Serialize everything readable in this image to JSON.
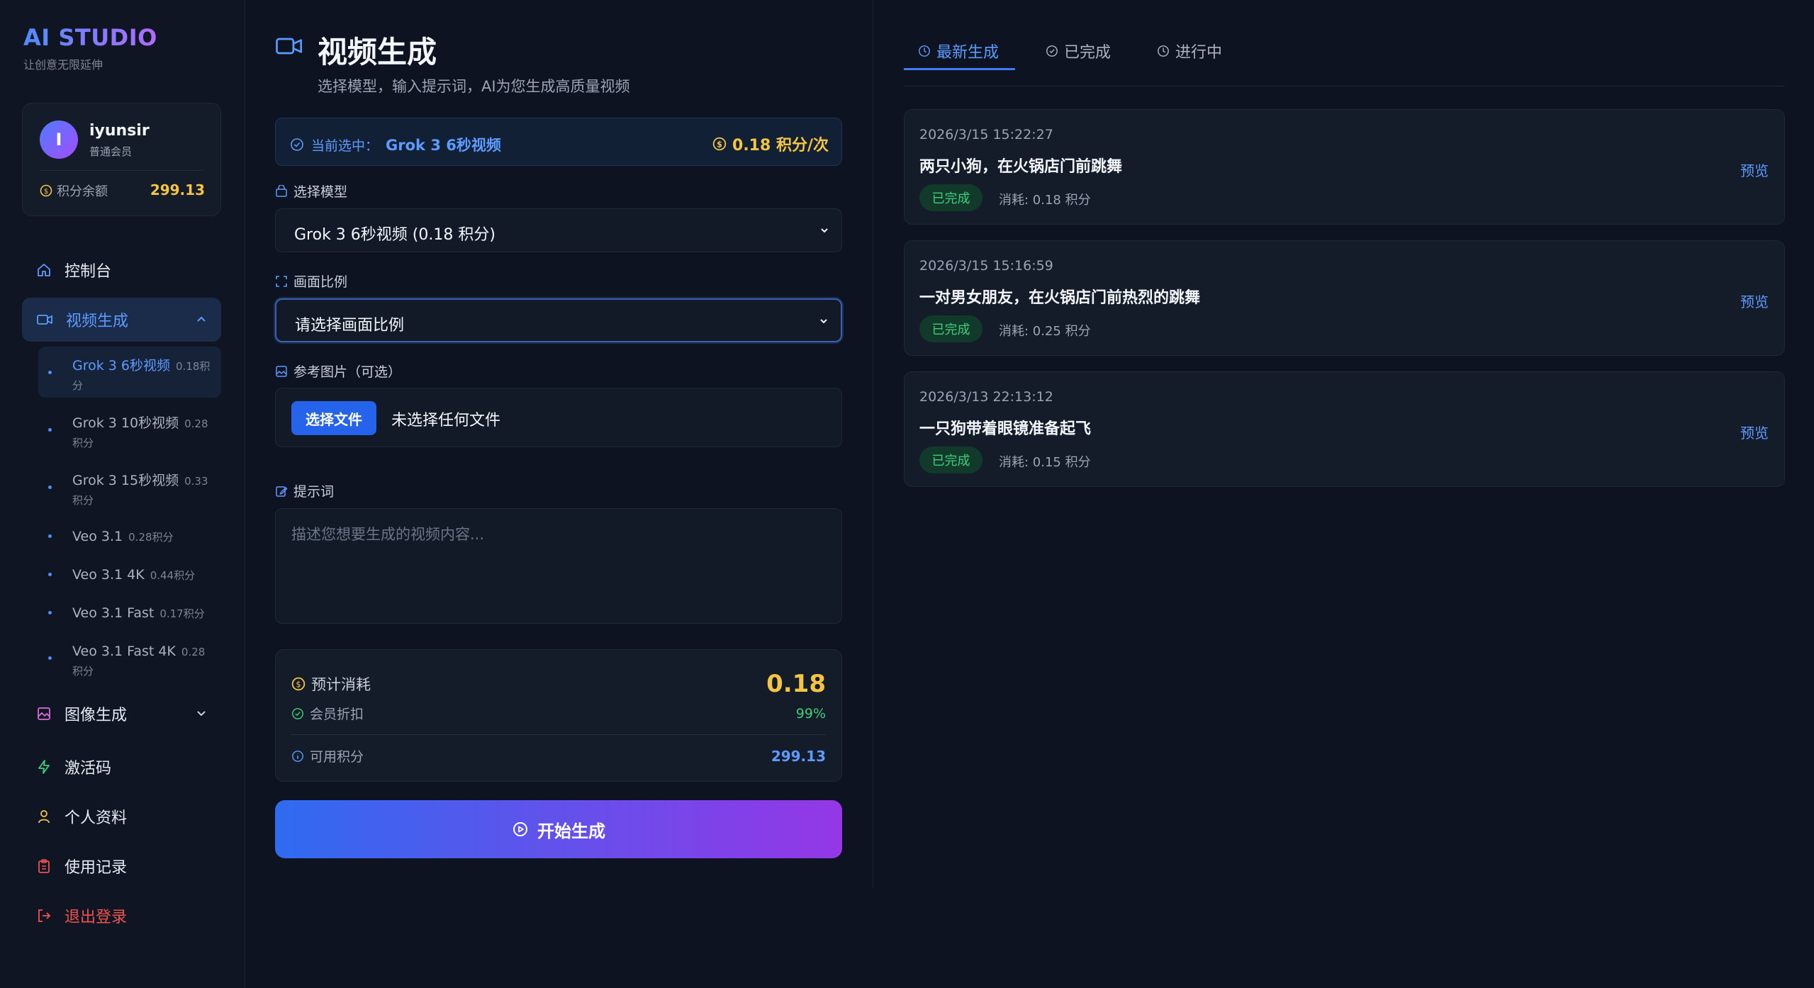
{
  "brand": {
    "title": "AI STUDIO",
    "subtitle": "让创意无限延伸"
  },
  "user": {
    "initial": "I",
    "name": "iyunsir",
    "role": "普通会员",
    "balance_label": "积分余额",
    "balance": "299.13"
  },
  "nav": {
    "dashboard": "控制台",
    "video": "视频生成",
    "image": "图像生成",
    "activation": "激活码",
    "profile": "个人资料",
    "history": "使用记录",
    "logout": "退出登录"
  },
  "video_models": [
    {
      "name": "Grok 3 6秒视频",
      "cost": "0.18积分"
    },
    {
      "name": "Grok 3 10秒视频",
      "cost": "0.28积分"
    },
    {
      "name": "Grok 3 15秒视频",
      "cost": "0.33积分"
    },
    {
      "name": "Veo 3.1",
      "cost": "0.28积分"
    },
    {
      "name": "Veo 3.1 4K",
      "cost": "0.44积分"
    },
    {
      "name": "Veo 3.1 Fast",
      "cost": "0.17积分"
    },
    {
      "name": "Veo 3.1 Fast 4K",
      "cost": "0.28积分"
    }
  ],
  "page": {
    "title": "视频生成",
    "subtitle": "选择模型，输入提示词，AI为您生成高质量视频",
    "selected_prefix": "当前选中：",
    "selected_model": "Grok 3 6秒视频",
    "selected_price": "0.18 积分/次",
    "model_label": "选择模型",
    "model_value": "Grok 3 6秒视频 (0.18 积分)",
    "ratio_label": "画面比例",
    "ratio_value": "请选择画面比例",
    "ref_label": "参考图片（可选）",
    "file_button": "选择文件",
    "file_status": "未选择任何文件",
    "prompt_label": "提示词",
    "prompt_placeholder": "描述您想要生成的视频内容...",
    "est_label": "预计消耗",
    "est_value": "0.18",
    "discount_label": "会员折扣",
    "discount_value": "99%",
    "avail_label": "可用积分",
    "avail_value": "299.13",
    "generate_button": "开始生成"
  },
  "tabs": [
    "最新生成",
    "已完成",
    "进行中"
  ],
  "records": [
    {
      "time": "2026/3/15 15:22:27",
      "title": "两只小狗，在火锅店门前跳舞",
      "status": "已完成",
      "cost": "消耗: 0.18 积分",
      "action": "预览"
    },
    {
      "time": "2026/3/15 15:16:59",
      "title": "一对男女朋友，在火锅店门前热烈的跳舞",
      "status": "已完成",
      "cost": "消耗: 0.25 积分",
      "action": "预览"
    },
    {
      "time": "2026/3/13 22:13:12",
      "title": "一只狗带着眼镜准备起飞",
      "status": "已完成",
      "cost": "消耗: 0.15 积分",
      "action": "预览"
    }
  ],
  "colors": {
    "accent": "#5c9bff",
    "gold": "#f5c542",
    "success": "#3fcf7a",
    "danger": "#f0524d"
  }
}
